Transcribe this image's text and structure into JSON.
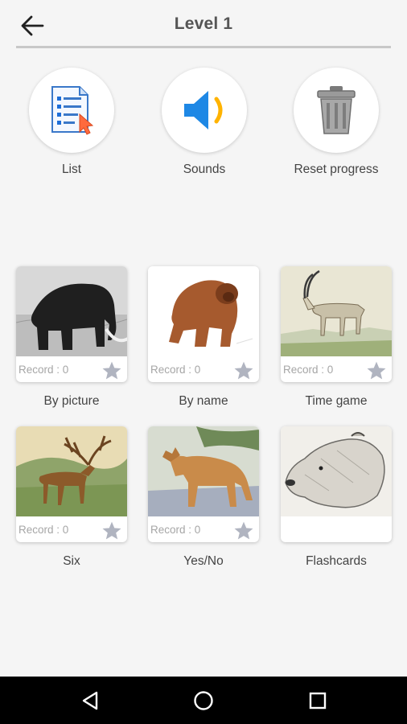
{
  "header": {
    "title": "Level 1",
    "back_icon": "arrow-left-icon"
  },
  "actions": [
    {
      "label": "List",
      "icon": "list-document-icon"
    },
    {
      "label": "Sounds",
      "icon": "speaker-icon"
    },
    {
      "label": "Reset progress",
      "icon": "trash-can-icon"
    }
  ],
  "games": [
    {
      "label": "By picture",
      "record": "Record : 0",
      "image": "mammoth-image"
    },
    {
      "label": "By name",
      "record": "Record : 0",
      "image": "ape-image"
    },
    {
      "label": "Time game",
      "record": "Record : 0",
      "image": "antelope-image"
    },
    {
      "label": "Six",
      "record": "Record : 0",
      "image": "irish-elk-image"
    },
    {
      "label": "Yes/No",
      "record": "Record : 0",
      "image": "wolf-image"
    },
    {
      "label": "Flashcards",
      "record": "",
      "image": "bear-sketch-image"
    }
  ],
  "colors": {
    "background": "#f5f5f5",
    "accent_blue": "#1e88e5",
    "star_gray": "#b0b4c0",
    "navbar": "#000000"
  },
  "navbar": {
    "back": "triangle-back-icon",
    "home": "circle-home-icon",
    "recents": "square-recents-icon"
  }
}
